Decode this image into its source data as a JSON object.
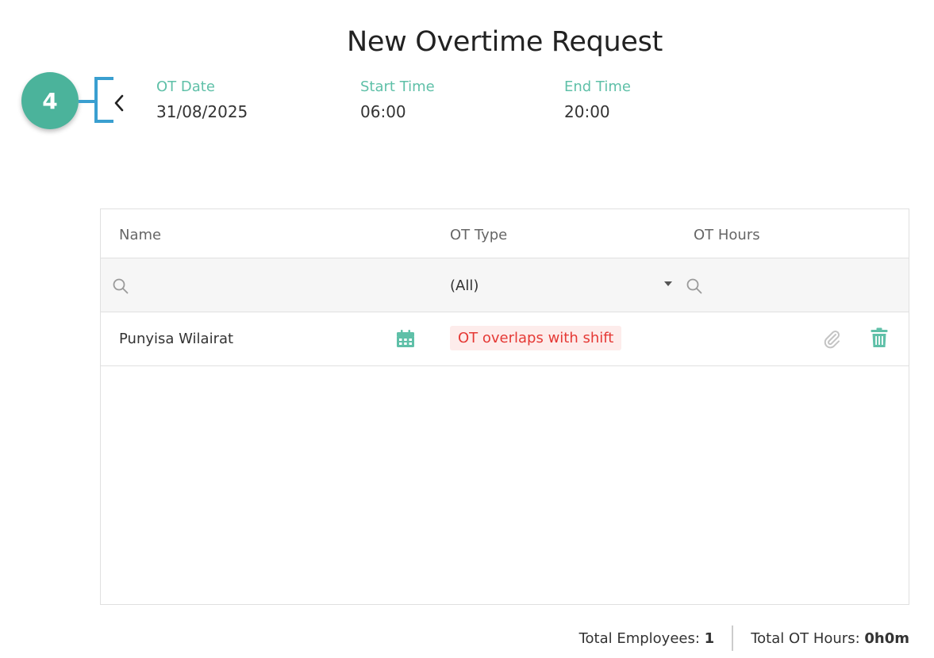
{
  "page": {
    "title": "New Overtime Request"
  },
  "annotation": {
    "step_number": "4"
  },
  "header": {
    "ot_date_label": "OT Date",
    "ot_date_value": "31/08/2025",
    "start_time_label": "Start Time",
    "start_time_value": "06:00",
    "end_time_label": "End Time",
    "end_time_value": "20:00"
  },
  "grid": {
    "columns": [
      "Name",
      "OT Type",
      "OT Hours"
    ],
    "filter": {
      "ot_type_selected": "(All)"
    },
    "rows": [
      {
        "name": "Punyisa Wilairat",
        "ot_type_status": "OT overlaps with shift"
      }
    ]
  },
  "footer": {
    "total_employees_label": "Total Employees:",
    "total_employees_value": "1",
    "total_ot_hours_label": "Total OT Hours:",
    "total_ot_hours_value": "0h0m"
  },
  "colors": {
    "accent": "#5fc0a8",
    "badge": "#4bb39b",
    "callout": "#3a9fd0",
    "warning_text": "#e53935",
    "warning_bg": "#fdeceb"
  }
}
